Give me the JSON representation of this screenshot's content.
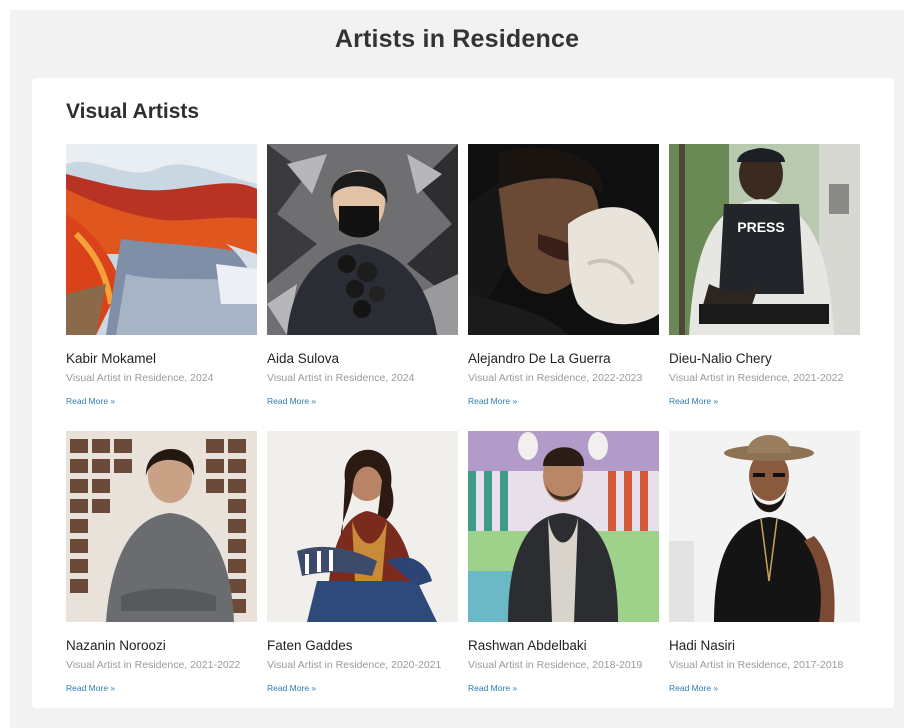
{
  "page": {
    "title": "Artists in Residence"
  },
  "section": {
    "title": "Visual Artists"
  },
  "artists": [
    {
      "name": "Kabir Mokamel",
      "role": "Visual Artist in Residence, 2024",
      "link": "Read More »"
    },
    {
      "name": "Aida Sulova",
      "role": "Visual Artist in Residence, 2024",
      "link": "Read More »"
    },
    {
      "name": "Alejandro De La Guerra",
      "role": "Visual Artist in Residence, 2022-2023",
      "link": "Read More »"
    },
    {
      "name": "Dieu-Nalio Chery",
      "role": "Visual Artist in Residence, 2021-2022",
      "link": "Read More »"
    },
    {
      "name": "Nazanin Noroozi",
      "role": "Visual Artist in Residence, 2021-2022",
      "link": "Read More »"
    },
    {
      "name": "Faten Gaddes",
      "role": "Visual Artist in Residence, 2020-2021",
      "link": "Read More »"
    },
    {
      "name": "Rashwan Abdelbaki",
      "role": "Visual Artist in Residence, 2018-2019",
      "link": "Read More »"
    },
    {
      "name": "Hadi Nasiri",
      "role": "Visual Artist in Residence, 2017-2018",
      "link": "Read More »"
    }
  ],
  "colors": {
    "background": "#f2f2f2",
    "card": "#ffffff",
    "link": "#2f7bb3",
    "muted": "#9a9a9a"
  }
}
